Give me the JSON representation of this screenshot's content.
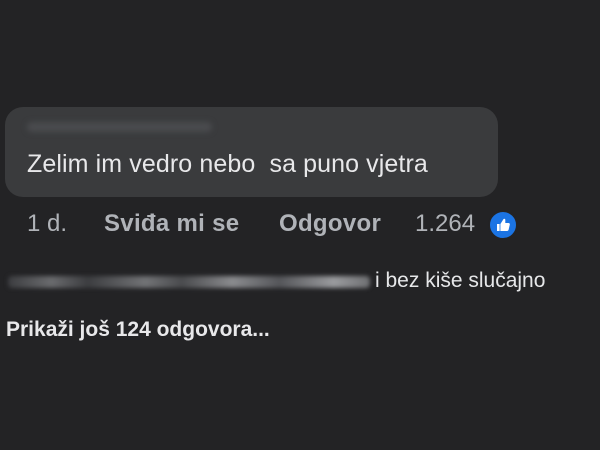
{
  "comment": {
    "text": "Zelim im vedro nebo  sa puno vjetra",
    "time": "1 d.",
    "like_label": "Sviđa mi se",
    "reply_label": "Odgovor",
    "reaction_count": "1.264",
    "reaction_icon": "thumbs-up-icon",
    "reaction_color": "#1b74e4"
  },
  "reply": {
    "text": "i bez kiše slučajno"
  },
  "more_replies": {
    "label": "Prikaži još 124 odgovora..."
  }
}
